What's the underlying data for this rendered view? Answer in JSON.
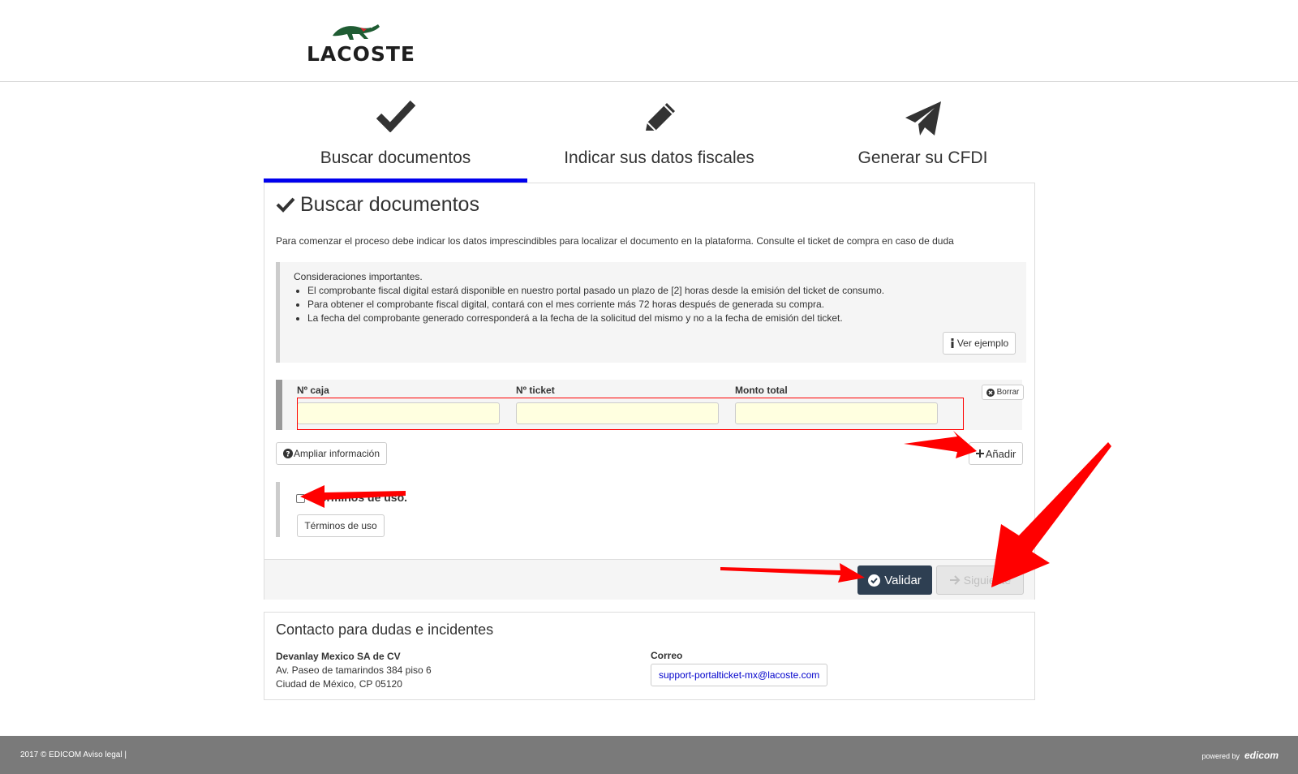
{
  "brand": {
    "name": "LACOSTE"
  },
  "steps": [
    {
      "label": "Buscar documentos",
      "icon": "check-icon",
      "active": true
    },
    {
      "label": "Indicar sus datos fiscales",
      "icon": "pencil-icon",
      "active": false
    },
    {
      "label": "Generar su CFDI",
      "icon": "paper-plane-icon",
      "active": false
    }
  ],
  "card": {
    "title": "Buscar documentos",
    "intro": "Para comenzar el proceso debe indicar los datos imprescindibles para localizar el documento en la plataforma. Consulte el ticket de compra en caso de duda",
    "info": {
      "title": "Consideraciones importantes.",
      "items": [
        "El comprobante fiscal digital estará disponible en nuestro portal pasado un plazo de [2] horas desde la emisión del ticket de consumo.",
        "Para obtener el comprobante fiscal digital, contará con el mes corriente más 72 horas después de generada su compra.",
        "La fecha del comprobante generado corresponderá a la fecha de la solicitud del mismo y no a la fecha de emisión del ticket."
      ],
      "example_button": "Ver ejemplo"
    },
    "fields": {
      "caja_label": "Nº caja",
      "ticket_label": "Nº ticket",
      "monto_label": "Monto total",
      "caja_value": "",
      "ticket_value": "",
      "monto_value": "",
      "clear_button": "Borrar"
    },
    "more_info_button": "Ampliar información",
    "add_button": "Añadir",
    "terms": {
      "label_visible": "...érminos de uso.",
      "checked": false,
      "button": "Términos de uso"
    },
    "validate_button": "Validar",
    "next_button": "Siguiente"
  },
  "contact": {
    "title": "Contacto para dudas e incidentes",
    "company": "Devanlay Mexico SA de CV",
    "address1": "Av. Paseo de tamarindos 384 piso 6",
    "address2": "Ciudad de México, CP 05120",
    "email_label": "Correo",
    "email": "support-portalticket-mx@lacoste.com"
  },
  "footer": {
    "copyright": "2017 © EDICOM",
    "legal": "Aviso legal",
    "separator": "|",
    "powered_by": "powered by",
    "powered_brand": "edicom"
  },
  "colors": {
    "accent": "#0000ee",
    "primary_button": "#2e3f52",
    "annotation": "#ff0000",
    "input_bg": "#ffffe0",
    "footer_bg": "#7a7a7a"
  }
}
